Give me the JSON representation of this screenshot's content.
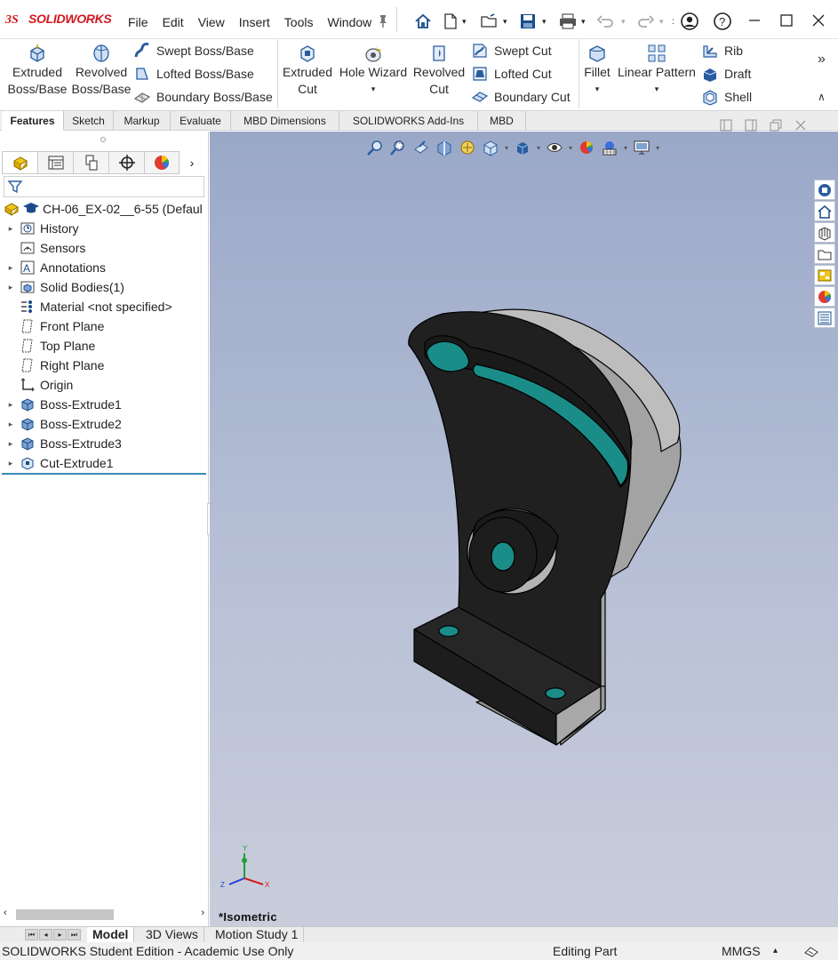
{
  "app": {
    "brand": "SOLIDWORKS"
  },
  "menu": [
    "File",
    "Edit",
    "View",
    "Insert",
    "Tools",
    "Window"
  ],
  "ribbon": {
    "extruded_boss": [
      "Extruded",
      "Boss/Base"
    ],
    "revolved_boss": [
      "Revolved",
      "Boss/Base"
    ],
    "swept_boss": "Swept Boss/Base",
    "lofted_boss": "Lofted Boss/Base",
    "boundary_boss": "Boundary Boss/Base",
    "extruded_cut": [
      "Extruded",
      "Cut"
    ],
    "hole_wizard": "Hole Wizard",
    "revolved_cut": [
      "Revolved",
      "Cut"
    ],
    "swept_cut": "Swept Cut",
    "lofted_cut": "Lofted Cut",
    "boundary_cut": "Boundary Cut",
    "fillet": "Fillet",
    "linear_pattern": "Linear Pattern",
    "rib": "Rib",
    "draft": "Draft",
    "shell": "Shell"
  },
  "tabs": [
    "Features",
    "Sketch",
    "Markup",
    "Evaluate",
    "MBD Dimensions",
    "SOLIDWORKS Add-Ins",
    "MBD"
  ],
  "tree": {
    "root": "CH-06_EX-02__6-55  (Defaul",
    "items": [
      {
        "label": "History",
        "expandable": true
      },
      {
        "label": "Sensors",
        "expandable": false
      },
      {
        "label": "Annotations",
        "expandable": true
      },
      {
        "label": "Solid Bodies(1)",
        "expandable": true
      },
      {
        "label": "Material <not specified>",
        "expandable": false
      },
      {
        "label": "Front Plane",
        "expandable": false
      },
      {
        "label": "Top Plane",
        "expandable": false
      },
      {
        "label": "Right Plane",
        "expandable": false
      },
      {
        "label": "Origin",
        "expandable": false
      },
      {
        "label": "Boss-Extrude1",
        "expandable": true
      },
      {
        "label": "Boss-Extrude2",
        "expandable": true
      },
      {
        "label": "Boss-Extrude3",
        "expandable": true
      },
      {
        "label": "Cut-Extrude1",
        "expandable": true
      }
    ]
  },
  "viewport": {
    "view_label": "*Isometric",
    "triad": {
      "x": "X",
      "y": "Y",
      "z": "Z"
    }
  },
  "bottom_tabs": [
    "Model",
    "3D Views",
    "Motion Study 1"
  ],
  "status": {
    "edition": "SOLIDWORKS Student Edition - Academic Use Only",
    "mode": "Editing Part",
    "units": "MMGS",
    "units_arrow": "▴"
  },
  "colors": {
    "accent": "#d0191f",
    "face_dark": "#1e1e1e",
    "face_grey": "#a6a6a6",
    "hole_cyan": "#1b8f8b",
    "selection_line": "#3c87b4"
  }
}
